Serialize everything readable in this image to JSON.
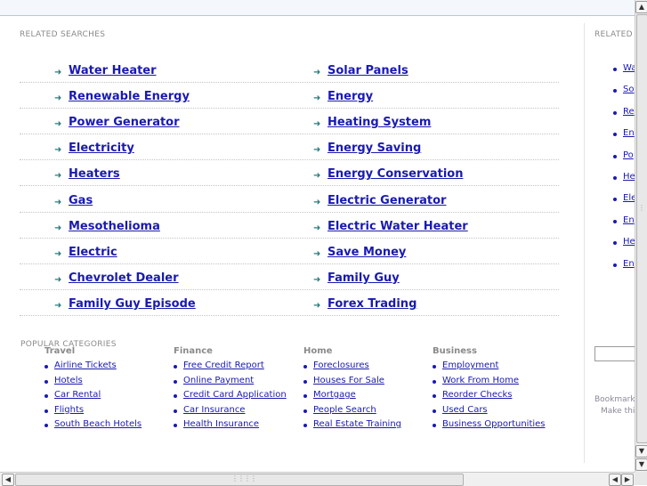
{
  "related_searches": {
    "title": "RELATED SEARCHES",
    "left": [
      "Water Heater",
      "Renewable Energy",
      "Power Generator",
      "Electricity",
      "Heaters",
      "Gas",
      "Mesothelioma",
      "Electric",
      "Chevrolet Dealer",
      "Family Guy Episode"
    ],
    "right": [
      "Solar Panels",
      "Energy",
      "Heating System",
      "Energy Saving",
      "Energy Conservation",
      "Electric Generator",
      "Electric Water Heater",
      "Save Money",
      "Family Guy",
      "Forex Trading"
    ]
  },
  "popular_categories": {
    "title": "POPULAR CATEGORIES",
    "columns": [
      {
        "heading": "Travel",
        "items": [
          "Airline Tickets",
          "Hotels",
          "Car Rental",
          "Flights",
          "South Beach Hotels"
        ]
      },
      {
        "heading": "Finance",
        "items": [
          "Free Credit Report",
          "Online Payment",
          "Credit Card Application",
          "Car Insurance",
          "Health Insurance"
        ]
      },
      {
        "heading": "Home",
        "items": [
          "Foreclosures",
          "Houses For Sale",
          "Mortgage",
          "People Search",
          "Real Estate Training"
        ]
      },
      {
        "heading": "Business",
        "items": [
          "Employment",
          "Work From Home",
          "Reorder Checks",
          "Used Cars",
          "Business Opportunities"
        ]
      }
    ]
  },
  "sidebar": {
    "title": "RELATED",
    "items": [
      "Wa",
      "So",
      "Re",
      "En",
      "Po",
      "He",
      "Ele",
      "En",
      "He",
      "En"
    ],
    "bookmark_line1": "Bookmark",
    "bookmark_line2": "Make thi"
  },
  "scrollbars": {
    "up": "▲",
    "down": "▼",
    "left": "◀",
    "right": "▶"
  },
  "colors": {
    "link": "#1a1ab0",
    "arrow": "#2a7a7a",
    "label": "#8a8a8a"
  }
}
